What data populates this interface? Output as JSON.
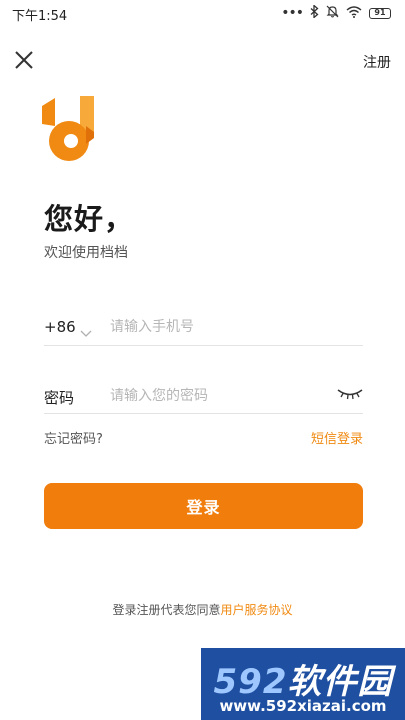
{
  "status_bar": {
    "time": "下午1:54",
    "icons": [
      "more-dots-icon",
      "bluetooth-icon",
      "mute-bell-icon",
      "wifi-icon",
      "battery-icon"
    ],
    "battery_level": "91"
  },
  "header": {
    "close_icon": "close-icon",
    "register_label": "注册"
  },
  "logo": {
    "icon": "app-logo",
    "brand_color": "#f08a12",
    "accent_color": "#f7a93a"
  },
  "greeting": {
    "title": "您好，",
    "subtitle": "欢迎使用档档"
  },
  "phone": {
    "country_code": "+86",
    "placeholder": "请输入手机号",
    "value": ""
  },
  "password": {
    "label": "密码",
    "placeholder": "请输入您的密码",
    "value": "",
    "toggle_icon": "eye-closed-icon"
  },
  "links": {
    "forgot": "忘记密码?",
    "sms_login": "短信登录"
  },
  "login_button": {
    "label": "登录",
    "color": "#f07d0c"
  },
  "agreement": {
    "prefix": "登录注册代表您同意",
    "link": "用户服务协议"
  },
  "watermark": {
    "brand_number": "592",
    "brand_text": "软件园",
    "url": "www.592xiazai.com"
  }
}
